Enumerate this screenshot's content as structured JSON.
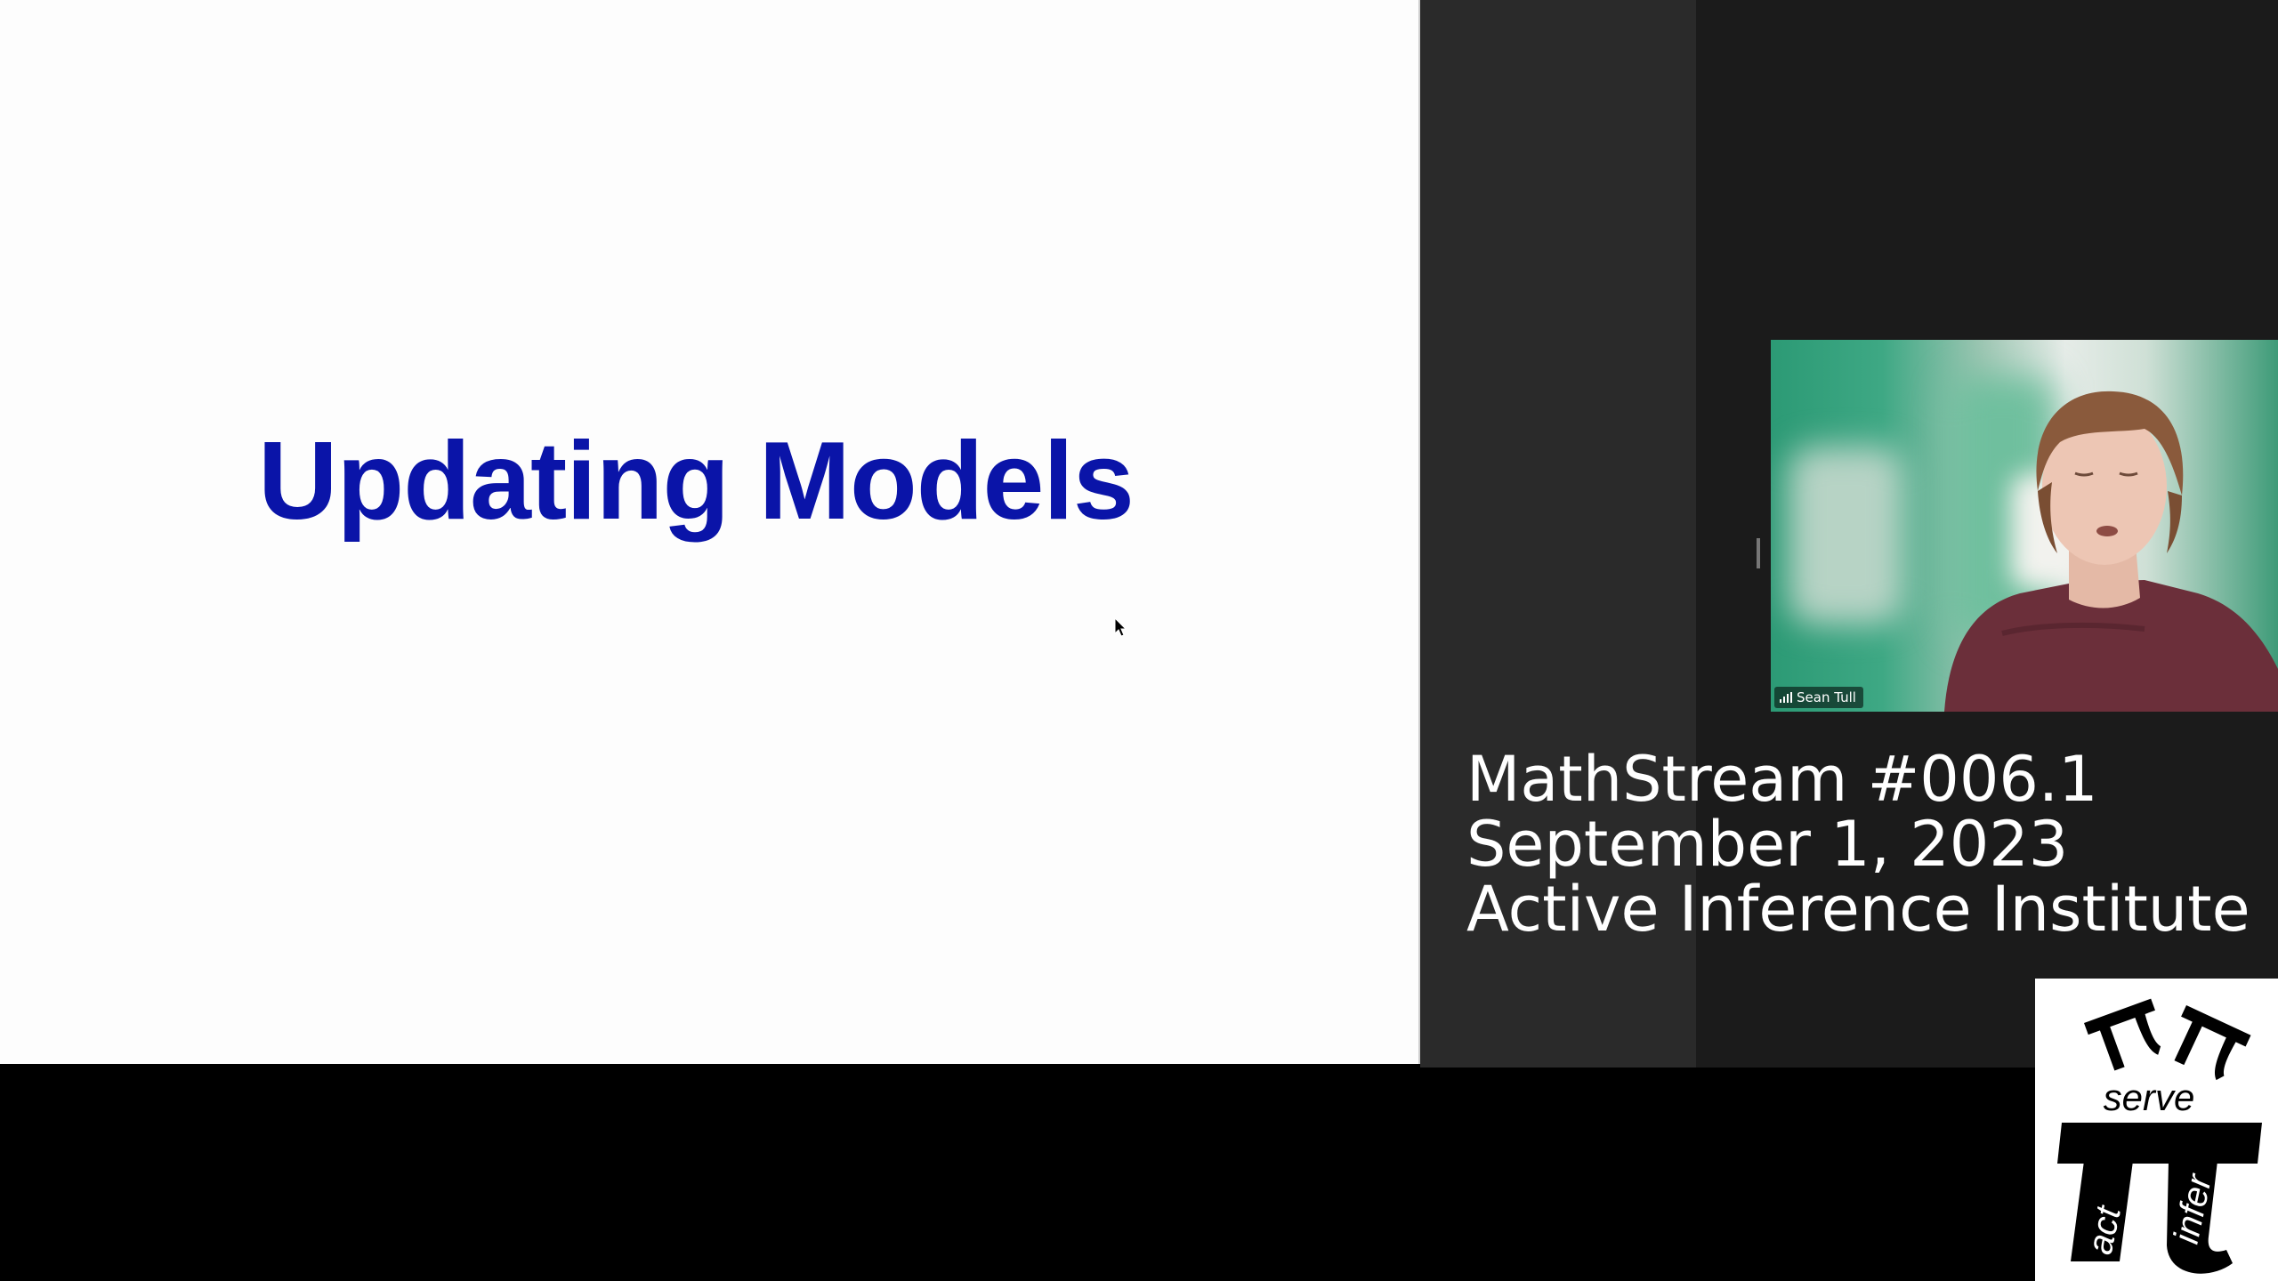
{
  "slide": {
    "title": "Updating Models",
    "title_color": "#0a14a8"
  },
  "participant": {
    "name": "Sean Tull",
    "icon": "signal-strength-icon"
  },
  "stream_info": {
    "line1": "MathStream #006.1",
    "line2": "September 1, 2023",
    "line3": "Active Inference Institute"
  },
  "logo": {
    "text_serve": "serve",
    "text_act": "act",
    "text_infer": "infer",
    "icon": "pi-logo-icon"
  }
}
